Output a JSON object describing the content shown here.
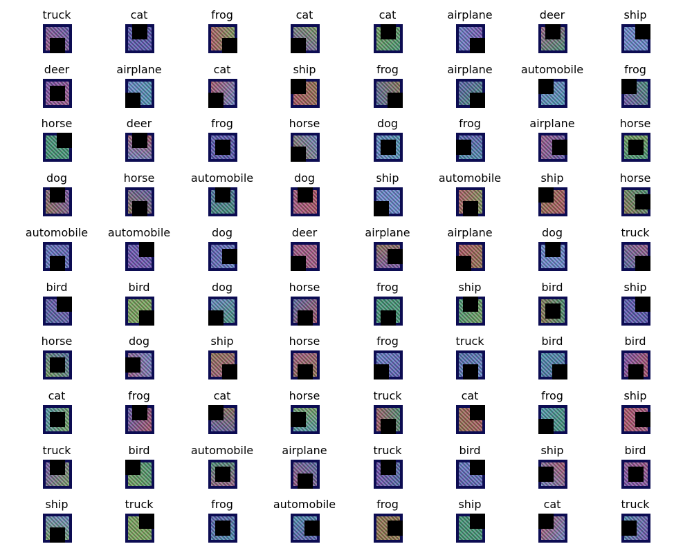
{
  "grid": {
    "rows": 10,
    "cols": 8,
    "labels": [
      [
        "truck",
        "cat",
        "frog",
        "cat",
        "cat",
        "airplane",
        "deer",
        "ship"
      ],
      [
        "deer",
        "airplane",
        "cat",
        "ship",
        "frog",
        "airplane",
        "automobile",
        "frog"
      ],
      [
        "horse",
        "deer",
        "frog",
        "horse",
        "dog",
        "frog",
        "airplane",
        "horse"
      ],
      [
        "dog",
        "horse",
        "automobile",
        "dog",
        "ship",
        "automobile",
        "ship",
        "horse"
      ],
      [
        "automobile",
        "automobile",
        "dog",
        "deer",
        "airplane",
        "airplane",
        "dog",
        "truck"
      ],
      [
        "bird",
        "bird",
        "dog",
        "horse",
        "frog",
        "ship",
        "bird",
        "ship"
      ],
      [
        "horse",
        "dog",
        "ship",
        "horse",
        "frog",
        "truck",
        "bird",
        "bird"
      ],
      [
        "cat",
        "frog",
        "cat",
        "horse",
        "truck",
        "cat",
        "frog",
        "ship"
      ],
      [
        "truck",
        "bird",
        "automobile",
        "airplane",
        "truck",
        "bird",
        "ship",
        "bird"
      ],
      [
        "ship",
        "truck",
        "frog",
        "automobile",
        "frog",
        "ship",
        "cat",
        "truck"
      ]
    ]
  },
  "colors": {
    "background": "#ffffff",
    "label_text": "#000000",
    "image_frame": "#0c0c52",
    "cutout": "#000000"
  }
}
